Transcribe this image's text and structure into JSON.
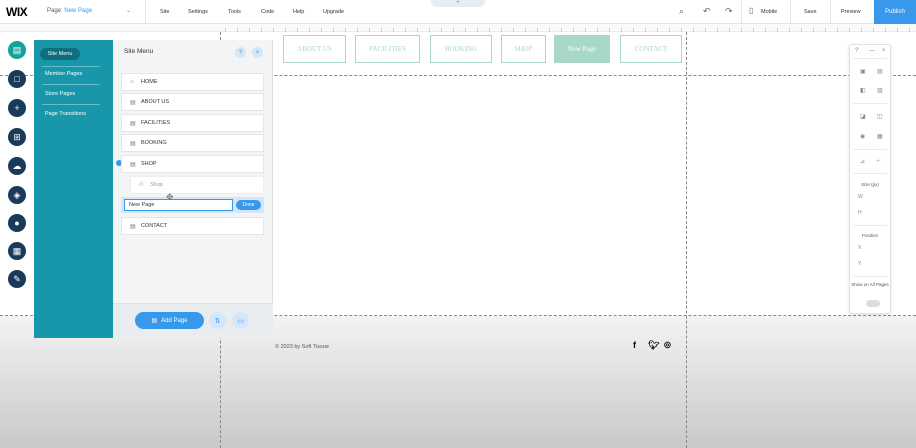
{
  "topbar": {
    "logo": "WIX",
    "page_label": "Page:",
    "page_name": "New Page",
    "menu": [
      "Site",
      "Settings",
      "Tools",
      "Code",
      "Help",
      "Upgrade"
    ],
    "mobile": "Mobile",
    "save": "Save",
    "preview": "Preview",
    "publish": "Publish",
    "add_tab": "+"
  },
  "site_nav": {
    "items": [
      "ABOUT US",
      "FACILITIES",
      "BOOKING",
      "SHOP",
      "New Page",
      "CONTACT"
    ],
    "active": "New Page"
  },
  "site_menu_panel": {
    "tabs": [
      "Site Menu",
      "Member Pages",
      "Store Pages",
      "Page Transitions"
    ],
    "title": "Site Menu",
    "help": "?",
    "close": "×",
    "pages": [
      "HOME",
      "ABOUT US",
      "FACILITIES",
      "BOOKING",
      "SHOP"
    ],
    "subpage": "Shop",
    "rename_value": "New Page",
    "done": "Done",
    "last_page": "CONTACT",
    "add_page": "Add Page"
  },
  "footer": {
    "copyright": "© 2023 by Soft Tissue",
    "social": [
      "f",
      "t",
      "ig"
    ]
  },
  "inspector": {
    "size_label": "Size (px)",
    "w": "W",
    "h": "H",
    "position_label": "Position",
    "x": "X",
    "y": "Y",
    "show_all": "Show on All Pages"
  },
  "colors": {
    "accent": "#3899ec",
    "panel_teal": "#1797a9",
    "nav_mint": "#a8d8c8",
    "toolbar_navy": "#1a3a5a"
  }
}
